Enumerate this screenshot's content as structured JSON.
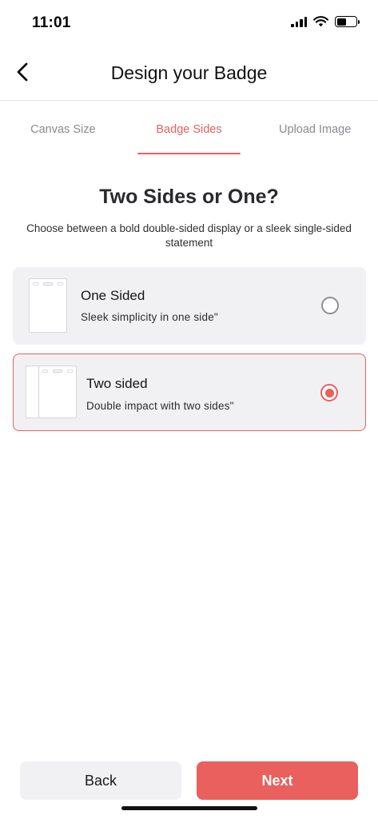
{
  "status_bar": {
    "time": "11:01",
    "signal_icon": "cellular-signal-icon",
    "wifi_icon": "wifi-icon",
    "battery_icon": "battery-icon",
    "battery_level": 0.5
  },
  "header": {
    "back_icon": "chevron-left-icon",
    "title": "Design your Badge"
  },
  "tabs": [
    {
      "label": "Canvas Size",
      "active": false
    },
    {
      "label": "Badge Sides",
      "active": true
    },
    {
      "label": "Upload Image",
      "active": false
    }
  ],
  "section": {
    "title": "Two Sides or One?",
    "subtitle": "Choose between a bold double-sided display or a sleek single-sided statement"
  },
  "options": [
    {
      "title": "One Sided",
      "description": "Sleek simplicity in one side\"",
      "selected": false,
      "icon": "single-badge-icon"
    },
    {
      "title": "Two sided",
      "description": "Double impact with two sides\"",
      "selected": true,
      "icon": "double-badge-icon"
    }
  ],
  "footer": {
    "back_label": "Back",
    "next_label": "Next"
  },
  "colors": {
    "accent": "#e8605e",
    "card_background": "#f1f1f4",
    "muted_text": "#8a8a90"
  }
}
